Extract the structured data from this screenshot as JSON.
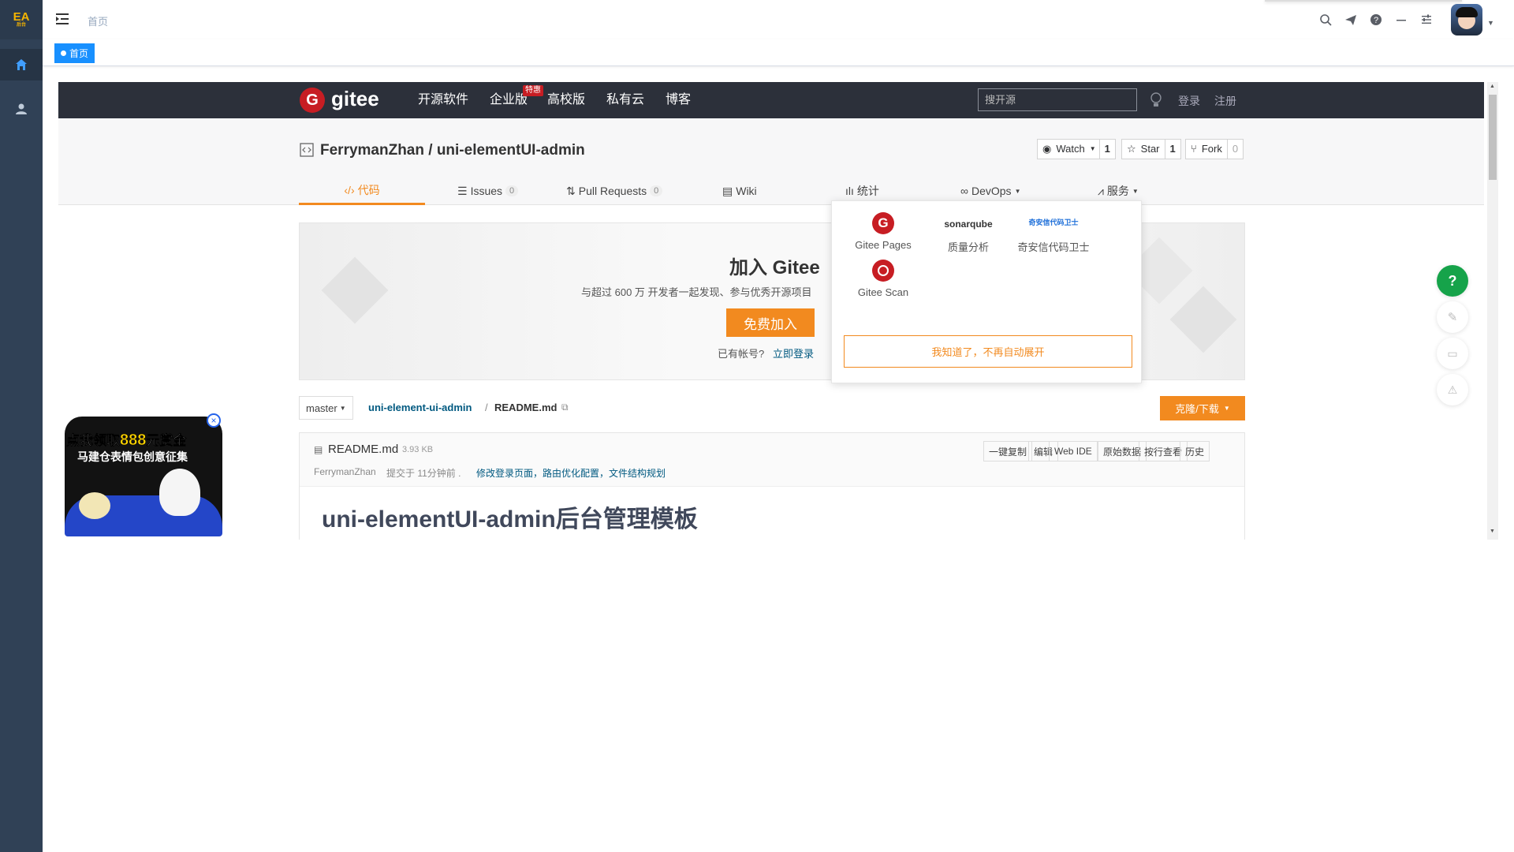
{
  "sidebar": {
    "logo_text": "EA",
    "logo_sub": "后台",
    "items": [
      {
        "icon": "home-icon"
      },
      {
        "icon": "user-icon"
      }
    ]
  },
  "header": {
    "breadcrumb": "首页",
    "icons": [
      "search-icon",
      "send-icon",
      "help-icon",
      "minimize-icon",
      "settings-icon",
      "avatar"
    ]
  },
  "tags": [
    {
      "label": "首页"
    }
  ],
  "gitee": {
    "brand": "gitee",
    "nav": [
      "开源软件",
      "企业版",
      "高校版",
      "私有云",
      "博客"
    ],
    "nav_badge": "特惠",
    "search_placeholder": "搜开源",
    "login": "登录",
    "register": "注册",
    "repo_title": "FerrymanZhan / uni-elementUI-admin",
    "watch": {
      "label": "Watch",
      "count": "1"
    },
    "star": {
      "label": "Star",
      "count": "1"
    },
    "fork": {
      "label": "Fork",
      "count": "0"
    },
    "tabs": [
      {
        "label": "代码",
        "active": true
      },
      {
        "label": "Issues",
        "count": "0"
      },
      {
        "label": "Pull Requests",
        "count": "0"
      },
      {
        "label": "Wiki"
      },
      {
        "label": "统计"
      },
      {
        "label": "DevOps"
      },
      {
        "label": "服务"
      }
    ],
    "banner": {
      "title": "加入 Gitee",
      "subtitle": "与超过 600 万 开发者一起发现、参与优秀开源项目",
      "join_button": "免费加入",
      "have_account": "已有帐号?",
      "login_now": "立即登录"
    },
    "services": [
      {
        "label": "Gitee Pages",
        "icon": "gitee-pages-icon"
      },
      {
        "label": "质量分析",
        "icon": "sonarqube-logo",
        "logo_text": "sonarqube"
      },
      {
        "label": "奇安信代码卫士",
        "icon": "qianxin-logo",
        "logo_text": "奇安信代码卫士"
      },
      {
        "label": "Gitee Scan",
        "icon": "gitee-scan-icon"
      }
    ],
    "dropdown_dismiss": "我知道了，不再自动展开",
    "branch": "master",
    "path_root": "uni-element-ui-admin",
    "path_file": "README.md",
    "clone_button": "克隆/下载",
    "readme": {
      "filename": "README.md",
      "size": "3.93 KB",
      "commit_author": "FerrymanZhan",
      "commit_text": "提交于 11分钟前 .",
      "commit_msg": "修改登录页面，路由优化配置，文件结构规划",
      "actions": [
        "一键复制",
        "编辑",
        "Web IDE",
        "原始数据",
        "按行查看",
        "历史"
      ],
      "heading": "uni-elementUI-admin后台管理模板"
    }
  },
  "ad": {
    "line1": "点我领取",
    "amount": "888",
    "line1_end": "元赏金",
    "line2": "马建仓表情包创意征集"
  },
  "colors": {
    "sidebar": "#304156",
    "gitee_nav": "#2c303a",
    "orange": "#f28a1f",
    "tag_blue": "#1890ff",
    "gitee_red": "#c71d23",
    "help_green": "#16a34a"
  }
}
